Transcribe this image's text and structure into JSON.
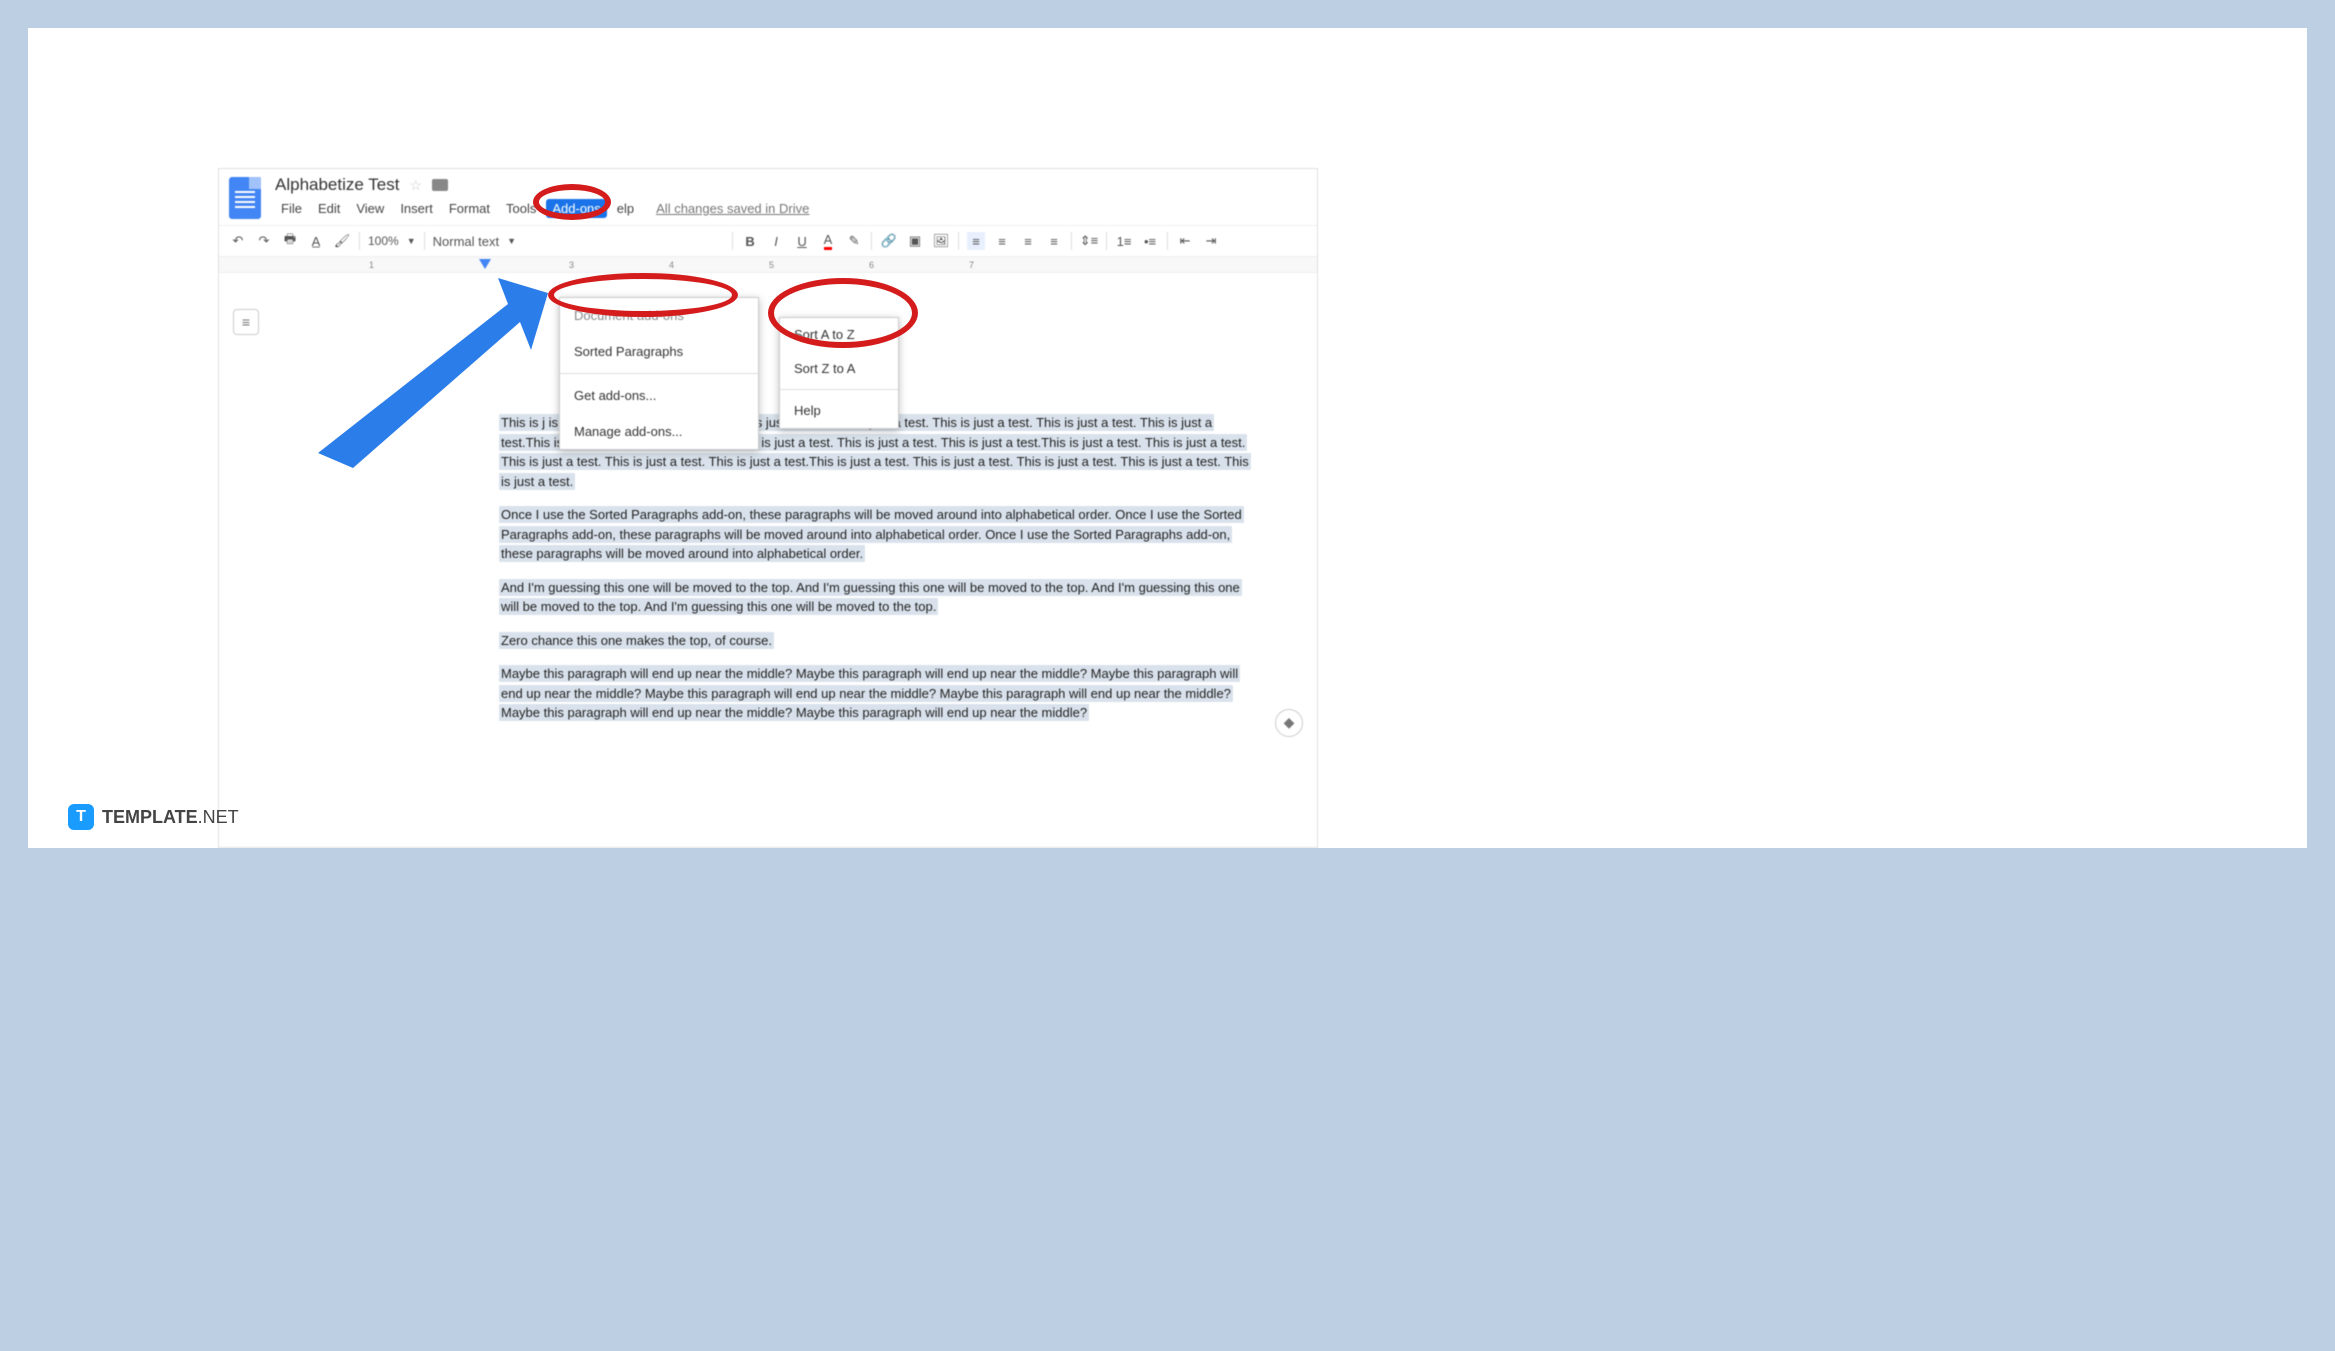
{
  "doc": {
    "title": "Alphabetize Test",
    "saved": "All changes saved in Drive"
  },
  "menu": {
    "file": "File",
    "edit": "Edit",
    "view": "View",
    "insert": "Insert",
    "format": "Format",
    "tools": "Tools",
    "addons": "Add-ons",
    "help": "elp"
  },
  "toolbar": {
    "zoom": "100%",
    "style": "Normal text"
  },
  "addons_menu": {
    "header": "Document add-ons",
    "sorted": "Sorted Paragraphs",
    "get": "Get add-ons...",
    "manage": "Manage add-ons..."
  },
  "sort_menu": {
    "az": "Sort A to Z",
    "za": "Sort Z to A",
    "help": "Help"
  },
  "ruler": {
    "n1": "1",
    "n3": "3",
    "n4": "4",
    "n5": "5",
    "n6": "6",
    "n7": "7"
  },
  "paras": {
    "p1": "This is j                                                                                is just a test. This is just a test.This is just a test. This is just a test. This is just a test. This is just a test. This is just a test.This is just a test. This is just a test. This is just a test. This is just a test. This is just a test.This is just a test. This is just a test. This is just a test. This is just a test. This is just a test.This is just a test. This is just a test. This is just a test. This is just a test. This is just a test.",
    "p2": "Once I use the Sorted Paragraphs add-on, these paragraphs will be moved around into alphabetical order. Once I use the Sorted Paragraphs add-on, these paragraphs will be moved around into alphabetical order. Once I use the Sorted Paragraphs add-on, these paragraphs will be moved around into alphabetical order.",
    "p3": "And I'm guessing this one will be moved to the top. And I'm guessing this one will be moved to the top. And I'm guessing this one will be moved to the top. And I'm guessing this one will be moved to the top.",
    "p4": "Zero chance this one makes the top, of course.",
    "p5": "Maybe this paragraph will end up near the middle? Maybe this paragraph will end up near the middle? Maybe this paragraph will end up near the middle? Maybe this paragraph will end up near the middle? Maybe this paragraph will end up near the middle? Maybe this paragraph will end up near the middle? Maybe this paragraph will end up near the middle?"
  },
  "watermark": {
    "brand": "TEMPLATE",
    "suffix": ".NET",
    "logo": "T"
  }
}
